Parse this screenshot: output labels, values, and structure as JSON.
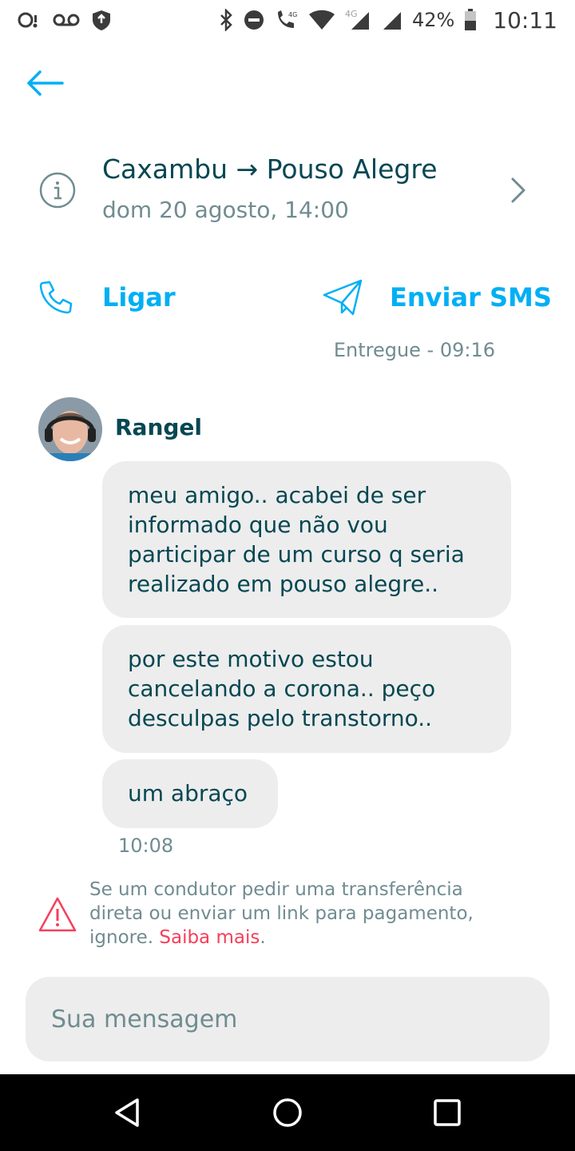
{
  "status_bar": {
    "battery": "42%",
    "time": "10:11",
    "network": "4G"
  },
  "trip": {
    "route": "Caxambu → Pouso Alegre",
    "date": "dom 20 agosto, 14:00"
  },
  "actions": {
    "call_label": "Ligar",
    "sms_label": "Enviar SMS"
  },
  "delivery_status": "Entregue - 09:16",
  "sender": {
    "name": "Rangel"
  },
  "messages": [
    "meu amigo.. acabei de ser informado que não vou participar de um curso q seria realizado em pouso alegre..",
    "por este motivo estou cancelando a corona.. peço desculpas pelo transtorno..",
    "um abraço"
  ],
  "message_time": "10:08",
  "warning": {
    "text": "Se um condutor pedir uma transferência direta ou enviar um link para pagamento, ignore. ",
    "link": "Saiba mais",
    "suffix": "."
  },
  "input": {
    "placeholder": "Sua mensagem"
  },
  "colors": {
    "accent": "#00aff5",
    "text_primary": "#054752",
    "text_secondary": "#708c91",
    "bubble": "#ededed",
    "danger": "#f53f5b"
  }
}
